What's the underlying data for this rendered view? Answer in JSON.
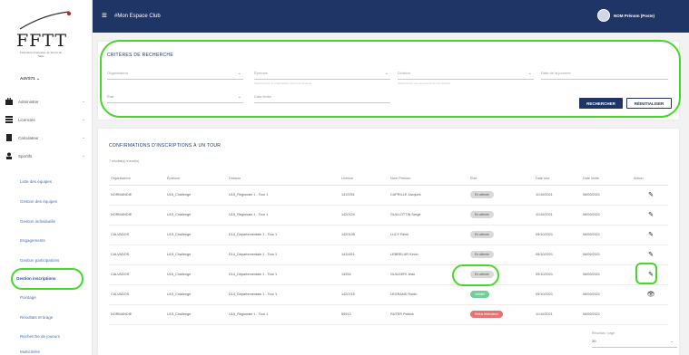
{
  "sidebar": {
    "logo_text": "FFTT",
    "logo_subtitle": "Fédération Française de Tennis de Table",
    "user": "A4VS71 ⌄",
    "items": [
      {
        "label": "Administrer",
        "icon": "briefcase-icon"
      },
      {
        "label": "Licenciés",
        "icon": "list-icon"
      },
      {
        "label": "Calculateur",
        "icon": "calculator-icon"
      },
      {
        "label": "Sportifs",
        "icon": "user-icon"
      }
    ],
    "subitems": [
      "Liste des équipes",
      "Gestion des équipes",
      "Gestion individuelle",
      "Engagements",
      "Gestion participations",
      "Gestion inscriptions",
      "Pointage",
      "Résultats et tirage",
      "Recherche de joueurs",
      "Multicritère"
    ]
  },
  "header": {
    "app_title": "#Mon Espace Club",
    "user_name": "NOM Prénom (Poste)"
  },
  "search": {
    "title": "CRITÈRES DE RECHERCHE",
    "fields": [
      {
        "label": "Organisateur",
        "hint": ""
      },
      {
        "label": "Épreuve",
        "hint": "Sélectionnez un organisateur pour une épreuve"
      },
      {
        "label": "Division",
        "hint": "Sélectionnez une épreuve pour une division"
      },
      {
        "label": "Date de la journée",
        "hint": ""
      },
      {
        "label": "État",
        "hint": ""
      },
      {
        "label": "Date limite",
        "hint": ""
      }
    ],
    "search_button": "RECHERCHER",
    "reset_button": "RÉINITIALISER"
  },
  "table": {
    "title": "CONFIRMATIONS D'INSCRIPTIONS À UN TOUR",
    "results": "7 résultat(s) trouvé(s)",
    "headers": [
      "Organisateur",
      "Épreuve",
      "Division",
      "Licence",
      "Nom Prénom",
      "État",
      "Date tour",
      "Date limite",
      "Action"
    ],
    "rows": [
      {
        "org": "NORMANDIE",
        "epreuve": "U15_Challenge",
        "division": "U15_Régionale 1 - Tour 1",
        "licence": "1413761",
        "nom": "CAPRILLE Jacques",
        "etat": "En attente",
        "etat_type": "grey",
        "date_tour": "11/10/2021",
        "date_limite": "06/09/2021",
        "action": "pencil-icon"
      },
      {
        "org": "NORMANDIE",
        "epreuve": "U15_Challenge",
        "division": "U15_Régionale 1 - Tour 1",
        "licence": "1420124",
        "nom": "GUILLOTTIN Serge",
        "etat": "En attente",
        "etat_type": "grey",
        "date_tour": "11/10/2021",
        "date_limite": "06/09/2021",
        "action": "pencil-icon"
      },
      {
        "org": "CALVADOS",
        "epreuve": "U15_Challenge",
        "division": "D14_Départementale 1 - Tour 1",
        "licence": "1420135",
        "nom": "LUCY Rémi",
        "etat": "En attente",
        "etat_type": "grey",
        "date_tour": "09/10/2021",
        "date_limite": "06/09/2021",
        "action": "pencil-icon"
      },
      {
        "org": "CALVADOS",
        "epreuve": "U15_Challenge",
        "division": "D14_Départementale 1 - Tour 1",
        "licence": "1411491",
        "nom": "LEBRELUR Kevin",
        "etat": "En attente",
        "etat_type": "grey",
        "date_tour": "09/10/2021",
        "date_limite": "06/09/2021",
        "action": "pencil-icon"
      },
      {
        "org": "CALVADOS",
        "epreuve": "U15_Challenge",
        "division": "D14_Départementale 1 - Tour 1",
        "licence": "14254",
        "nom": "GUILDERI Jean",
        "etat": "En attente",
        "etat_type": "grey",
        "date_tour": "09/10/2021",
        "date_limite": "06/09/2021",
        "action": "pencil-icon"
      },
      {
        "org": "CALVADOS",
        "epreuve": "U15_Challenge",
        "division": "D14_Départementale 1 - Tour 1",
        "licence": "1420715",
        "nom": "LEGRAND Robin",
        "etat": "Validée",
        "etat_type": "green",
        "date_tour": "09/10/2021",
        "date_limite": "06/09/2021",
        "action": "eye-icon"
      },
      {
        "org": "NORMANDIE",
        "epreuve": "U15_Challenge",
        "division": "U15_Régionale 1 - Tour 1",
        "licence": "50913",
        "nom": "RUTER Patrick",
        "etat": "Refus fédération",
        "etat_type": "red",
        "date_tour": "11/10/2021",
        "date_limite": "06/09/2021",
        "action": ""
      }
    ],
    "per_page_label": "Résultats / page",
    "per_page_value": "20"
  },
  "colors": {
    "header_bg": "#1f3566",
    "annotation": "#48d62a"
  }
}
